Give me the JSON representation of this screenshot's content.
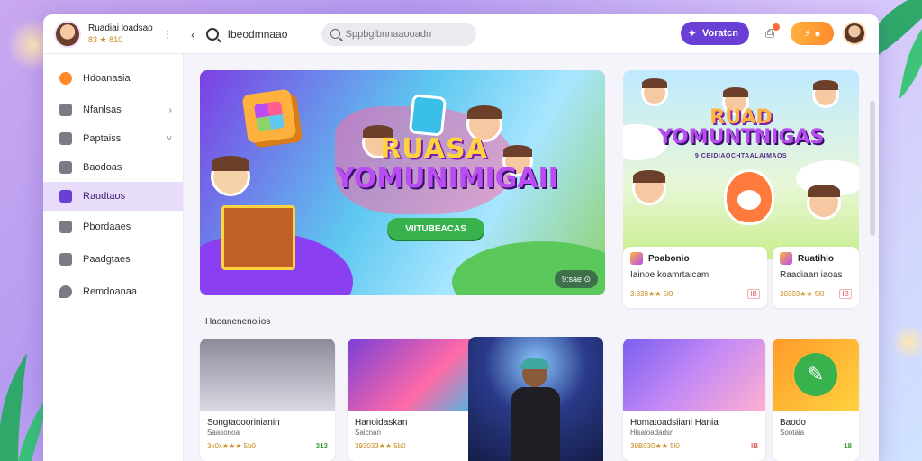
{
  "header": {
    "profile_name": "Ruadiai loadsao",
    "profile_sub": "83 ★ 810",
    "menu_dots": "⋮",
    "back": "‹",
    "page_title": "Ibeodmnaao",
    "search_placeholder": "Sppbglbnnaaooadn",
    "cta_label": "Voratcn",
    "coins_label": "⚡ ●"
  },
  "sidebar": {
    "items": [
      {
        "label": "Hdoanasia"
      },
      {
        "label": "Nfanlsas",
        "chev": "›"
      },
      {
        "label": "Paptaiss",
        "chev": "˅"
      },
      {
        "label": "Baodoas"
      },
      {
        "label": "Raudtaos"
      },
      {
        "label": "Pbordaaes"
      },
      {
        "label": "Paadgtaes"
      },
      {
        "label": "Remdoanaa"
      }
    ]
  },
  "hero": {
    "title_line1": "RUASA",
    "title_line2": "YOMUNIMIGAII",
    "button_label": "VIITUBEACAS",
    "badge": "9:sae ⊙"
  },
  "featured": {
    "title_line1": "RUAD",
    "title_line2": "YOMUNTNIGAS",
    "subtitle": "9 CBIDIAOCHTAALAIMAOS",
    "card_a": {
      "name": "Poabonio",
      "desc": "Iainoe koamrtaicam",
      "rating": "3:838★★ 5l0",
      "tag": "IB"
    },
    "card_b": {
      "name": "Ruatihio",
      "desc": "Raadiaan iaoas",
      "rating": "30303★★ 5l0",
      "tag": "IB"
    }
  },
  "section": {
    "label": "Haoanenenoiios"
  },
  "grid": [
    {
      "title": "Songtaooorinianin",
      "sub": "Saasonoa",
      "rating": "3x0x★★★ 5b0",
      "count": "313"
    },
    {
      "title": "Hanoidaskan",
      "sub": "Saicnan",
      "rating": "393033★★ 5b0",
      "count": "3"
    },
    {
      "title": "Homatoadsiiani Hania",
      "sub": "Hisaloadadsn",
      "rating": "39B030★★ 5l0",
      "count": "IB"
    },
    {
      "title": "Baodo",
      "sub": "Sootaia",
      "rating": "",
      "count": "18"
    }
  ],
  "colors": {
    "accent": "#6a3fd6",
    "sidebar_active": "#e8dcfb",
    "coin": "#ff8a2a",
    "hero_button": "#37b24d"
  }
}
